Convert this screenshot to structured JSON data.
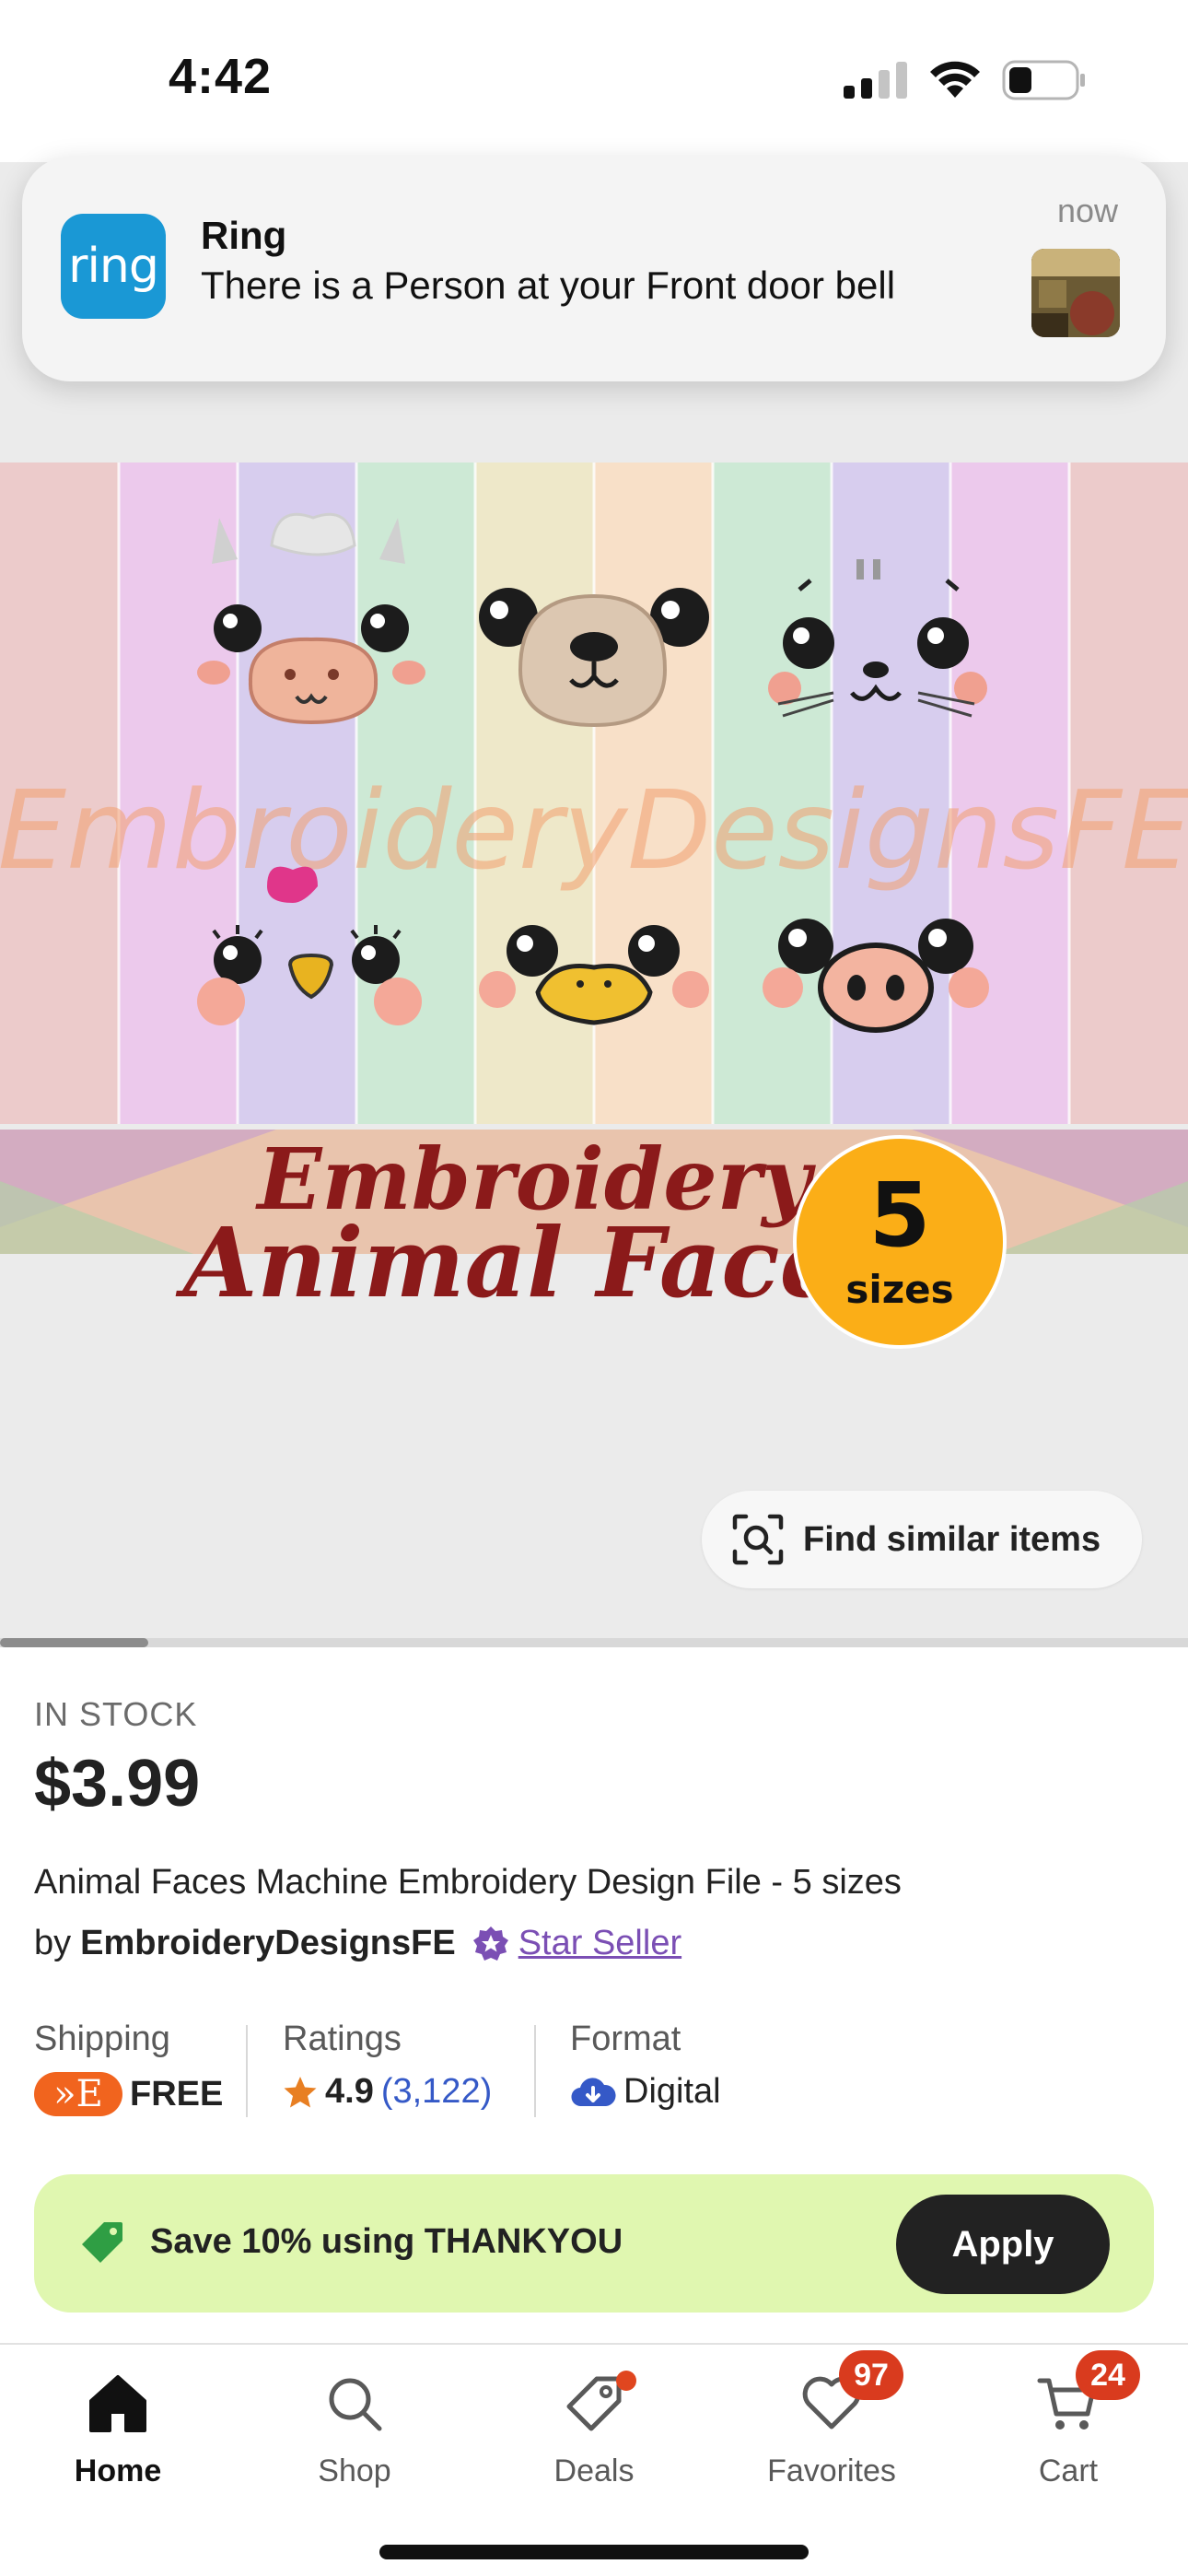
{
  "status_bar": {
    "time": "4:42"
  },
  "notification": {
    "app_name": "Ring",
    "logo_text": "ring",
    "message": "There is a Person at your Front door bell",
    "time": "now"
  },
  "gallery": {
    "watermark": "EmbroideryDesignsFE",
    "banner_line1": "Embroidery",
    "banner_line2": "Animal Faces",
    "badge_number": "5",
    "badge_text": "sizes",
    "find_similar_label": "Find similar items",
    "scroll_position": 0.125
  },
  "product": {
    "stock": "IN STOCK",
    "price": "$3.99",
    "title": "Animal Faces Machine Embroidery Design File - 5 sizes",
    "by_label": "by",
    "shop_name": "EmbroideryDesignsFE",
    "star_seller": "Star Seller"
  },
  "facts": {
    "shipping_label": "Shipping",
    "shipping_badge": "»E",
    "shipping_value": "FREE",
    "ratings_label": "Ratings",
    "rating": "4.9",
    "rating_count": "(3,122)",
    "format_label": "Format",
    "format_value": "Digital"
  },
  "promo": {
    "text": "Save 10% using THANKYOU",
    "button": "Apply"
  },
  "tabs": [
    {
      "label": "Home",
      "icon": "home-icon",
      "active": true
    },
    {
      "label": "Shop",
      "icon": "search-icon"
    },
    {
      "label": "Deals",
      "icon": "tag-icon",
      "dot": true
    },
    {
      "label": "Favorites",
      "icon": "heart-icon",
      "badge": "97"
    },
    {
      "label": "Cart",
      "icon": "cart-icon",
      "badge": "24"
    }
  ],
  "colors": {
    "accent_orange": "#f1641e",
    "star_seller_purple": "#7b4fb4",
    "promo_green": "#e0f7b0",
    "badge_red": "#d93b1e",
    "ring_blue": "#1a98d5"
  }
}
